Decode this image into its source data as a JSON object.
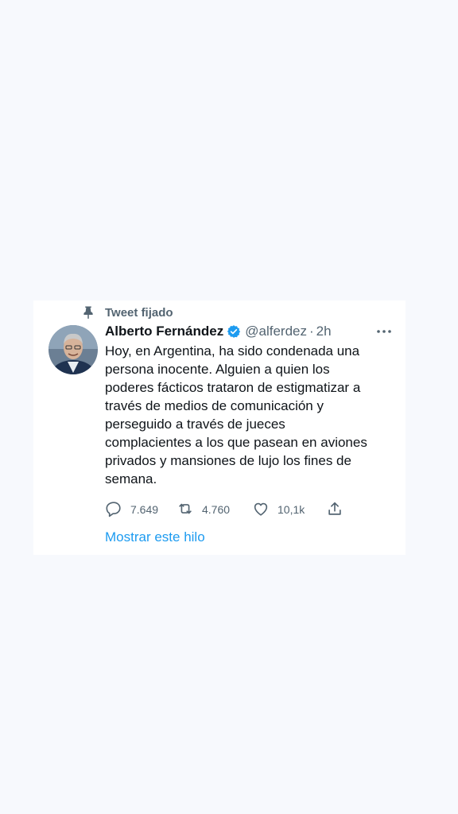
{
  "pinned": {
    "label": "Tweet fijado",
    "icon": "pin-icon"
  },
  "tweet": {
    "author_name": "Alberto Fernández",
    "verified_icon": "verified-badge-icon",
    "handle": "@alferdez",
    "separator": "·",
    "time": "2h",
    "more_icon": "more-options-icon",
    "text": "Hoy, en Argentina, ha sido condenada una\npersona inocente. Alguien a quien los\npoderes fácticos trataron de estigmatizar a\ntravés de medios de comunicación y\nperseguido a través de jueces\ncomplacientes a los que pasean en aviones\nprivados y mansiones de lujo los fines de\nsemana.",
    "actions": {
      "replies": "7.649",
      "retweets": "4.760",
      "likes": "10,1k"
    }
  },
  "show_thread_label": "Mostrar este hilo",
  "colors": {
    "background": "#f7f9fd",
    "card": "#ffffff",
    "primary_text": "#0f1419",
    "secondary_text": "#536471",
    "accent": "#1d9bf0"
  }
}
